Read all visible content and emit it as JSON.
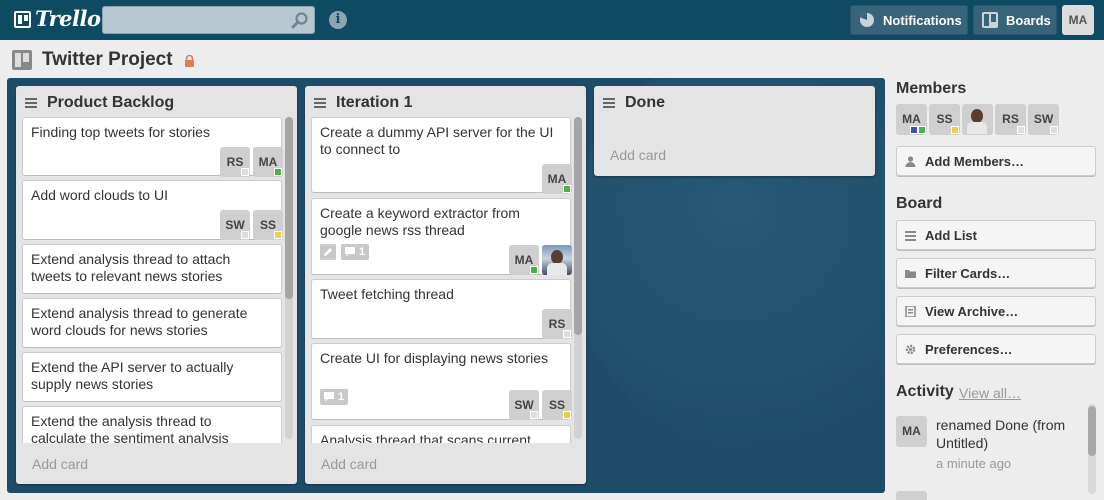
{
  "header": {
    "logo": "Trello",
    "search": {
      "placeholder": "",
      "value": ""
    },
    "notifications_label": "Notifications",
    "boards_label": "Boards",
    "user_initials": "MA"
  },
  "board": {
    "title": "Twitter Project"
  },
  "lists": [
    {
      "title": "Product Backlog",
      "cards": [
        {
          "title": "Finding top tweets for stories",
          "members": [
            "RS",
            "MA"
          ]
        },
        {
          "title": "Add word clouds to UI",
          "members": [
            "SW",
            "SS"
          ]
        },
        {
          "title": "Extend analysis thread to attach tweets to relevant news stories",
          "members": []
        },
        {
          "title": "Extend analysis thread to generate word clouds for news stories",
          "members": []
        },
        {
          "title": "Extend the API server to actually supply news stories",
          "members": []
        },
        {
          "title": "Extend the analysis thread to calculate the sentiment analysis",
          "members": []
        }
      ],
      "add_card": "Add card"
    },
    {
      "title": "Iteration 1",
      "cards": [
        {
          "title": "Create a dummy API server for the UI to connect to",
          "members": [
            "MA"
          ]
        },
        {
          "title": "Create a keyword extractor from google news rss thread",
          "members": [
            "MA"
          ],
          "badges": {
            "comments": "1"
          }
        },
        {
          "title": "Tweet fetching thread",
          "members": [
            "RS"
          ]
        },
        {
          "title": "Create UI for displaying news stories",
          "members": [
            "SW",
            "SS"
          ],
          "badges": {
            "comments": "1"
          }
        },
        {
          "title": "Analysis thread that scans current",
          "members": []
        }
      ],
      "add_card": "Add card"
    },
    {
      "title": "Done",
      "cards": [],
      "add_card": "Add card"
    }
  ],
  "sidebar": {
    "members_heading": "Members",
    "members": [
      "MA",
      "SS",
      "RS",
      "SW"
    ],
    "add_members": "Add Members…",
    "board_heading": "Board",
    "board_actions": [
      "Add List",
      "Filter Cards…",
      "View Archive…",
      "Preferences…"
    ],
    "activity_heading": "Activity",
    "view_all": "View all…",
    "activity": [
      {
        "user": "MA",
        "text": "renamed Done (from Untitled)",
        "time": "a minute ago"
      }
    ]
  },
  "colors": {
    "header_bg": "#0f4a63",
    "board_bg": "#1e4c68",
    "label_green": "#4caf50",
    "label_yellow": "#e8d04a",
    "label_blue": "#3f51b5"
  }
}
